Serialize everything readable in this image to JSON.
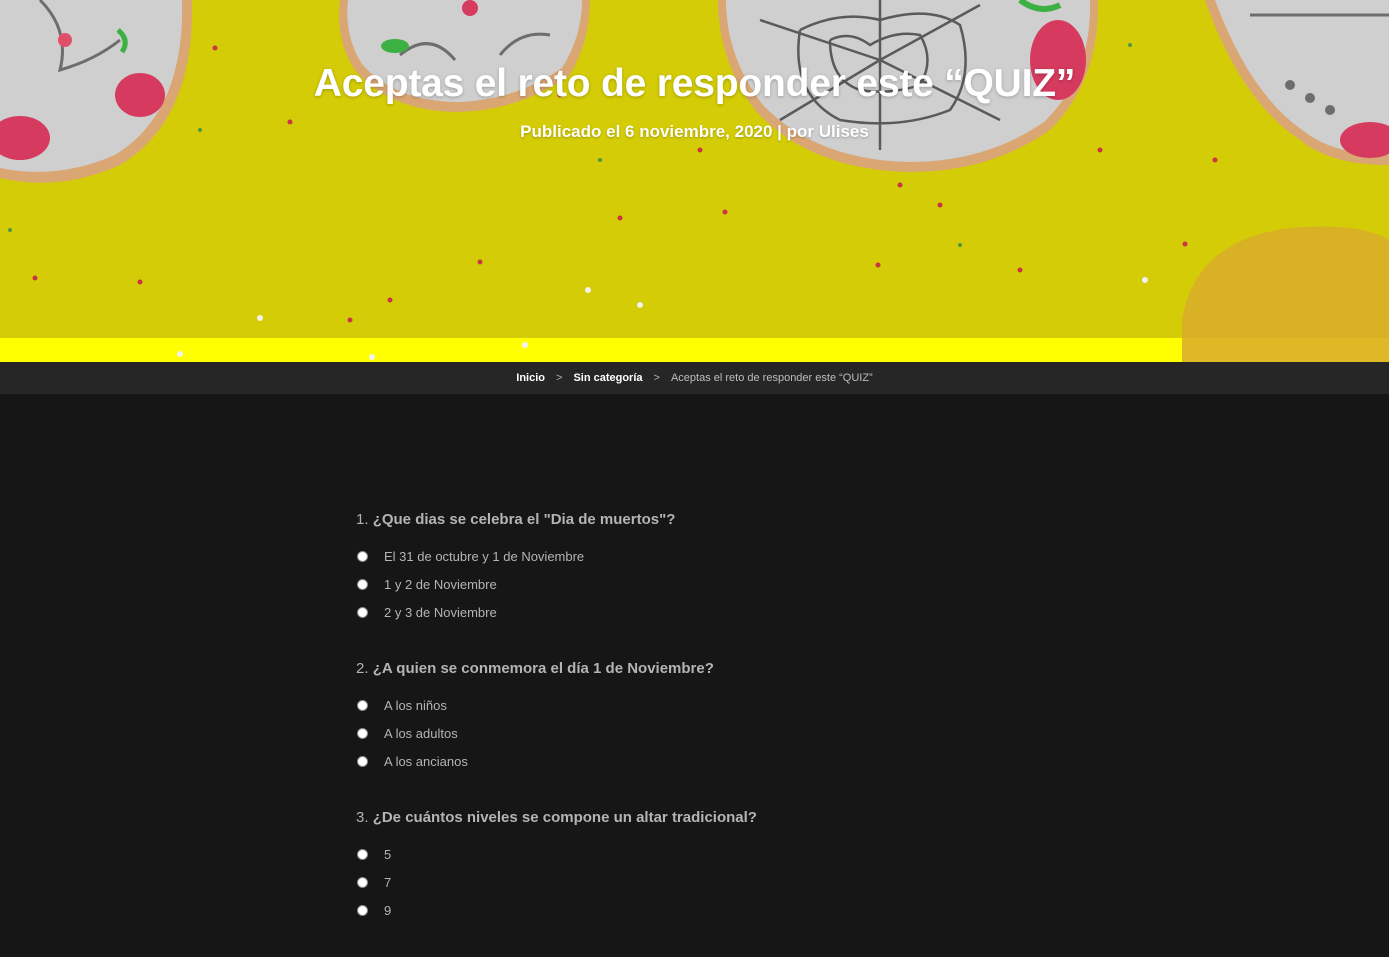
{
  "hero": {
    "title": "Aceptas el reto de responder este “QUIZ”",
    "meta_prefix": "Publicado el ",
    "date": "6 noviembre, 2020",
    "meta_separator": " | por ",
    "author": "Ulises",
    "colors": {
      "background": "#d6cf05",
      "bottom_strip": "#ffff00"
    }
  },
  "breadcrumb": {
    "home": "Inicio",
    "separator_1": ">",
    "category": "Sin categoría",
    "separator_2": ">",
    "current": "Aceptas el reto de responder este “QUIZ”"
  },
  "quiz": {
    "questions": [
      {
        "number": "1.",
        "text": "¿Que dias se celebra el \"Dia de muertos\"?",
        "options": [
          "El 31 de octubre y 1 de Noviembre",
          "1 y 2 de Noviembre",
          "2 y 3 de Noviembre"
        ]
      },
      {
        "number": "2.",
        "text": "¿A quien se conmemora el día 1 de Noviembre?",
        "options": [
          "A los niños",
          "A los adultos",
          "A los ancianos"
        ]
      },
      {
        "number": "3.",
        "text": "¿De cuántos niveles se compone un altar tradicional?",
        "options": [
          "5",
          "7",
          "9"
        ]
      }
    ]
  }
}
